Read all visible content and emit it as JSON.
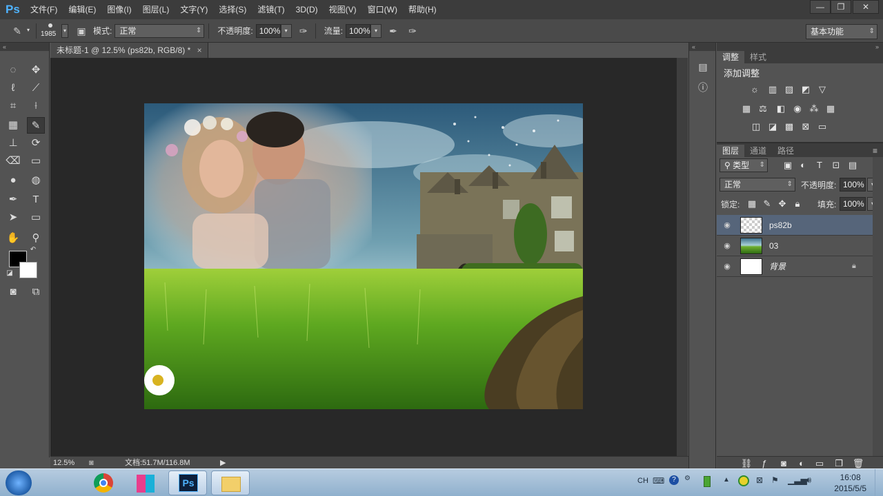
{
  "app": {
    "logo": "Ps"
  },
  "menu": [
    "文件(F)",
    "编辑(E)",
    "图像(I)",
    "图层(L)",
    "文字(Y)",
    "选择(S)",
    "滤镜(T)",
    "3D(D)",
    "视图(V)",
    "窗口(W)",
    "帮助(H)"
  ],
  "window_controls": {
    "minimize": "—",
    "restore": "❐",
    "close": "✕"
  },
  "options": {
    "brush_size": "1985",
    "mode_label": "模式:",
    "mode_value": "正常",
    "opacity_label": "不透明度:",
    "opacity_value": "100%",
    "flow_label": "流量:",
    "flow_value": "100%",
    "workspace": "基本功能"
  },
  "document": {
    "tab_title": "未标题-1 @ 12.5% (ps82b, RGB/8) *",
    "zoom": "12.5%",
    "doc_info": "文档:51.7M/116.8M"
  },
  "adjustments_panel": {
    "tabs": [
      "调整",
      "样式"
    ],
    "title": "添加调整"
  },
  "layers_panel": {
    "tabs": [
      "图层",
      "通道",
      "路径"
    ],
    "filter_kind": "类型",
    "blend_mode": "正常",
    "opacity_label": "不透明度:",
    "opacity_value": "100%",
    "lock_label": "锁定:",
    "fill_label": "填充:",
    "fill_value": "100%",
    "layers": [
      {
        "name": "ps82b",
        "selected": true
      },
      {
        "name": "03",
        "selected": false
      },
      {
        "name": "背景",
        "selected": false,
        "locked": true
      }
    ]
  },
  "taskbar": {
    "lang": "CH",
    "time": "16:08",
    "date": "2015/5/5",
    "ps_label": "Ps"
  },
  "colors": {
    "accent_ps": "#4fb3ff",
    "layer_selected": "#56657a",
    "foreground": "#000000",
    "background": "#ffffff"
  }
}
